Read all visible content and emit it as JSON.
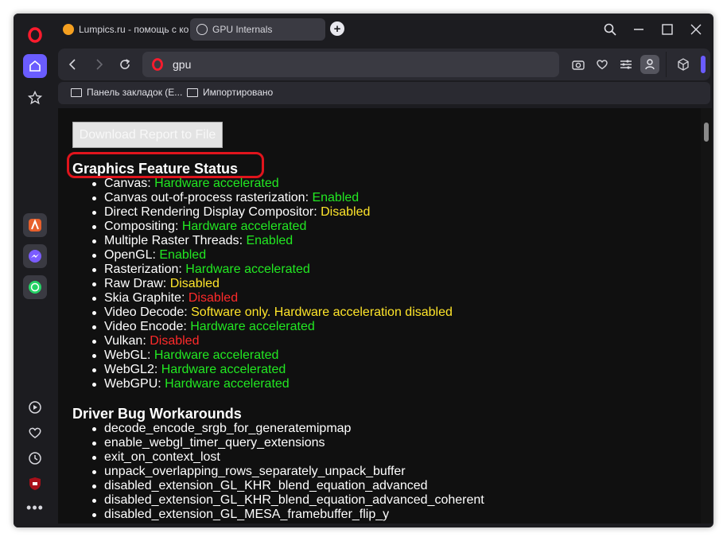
{
  "tabs": [
    {
      "title": "Lumpics.ru - помощь с ко",
      "active": false
    },
    {
      "title": "GPU Internals",
      "active": true
    }
  ],
  "address": {
    "url": "gpu"
  },
  "bookmarks": [
    {
      "label": "Панель закладок (E..."
    },
    {
      "label": "Импортировано"
    }
  ],
  "page": {
    "download_button": "Download Report to File",
    "feature_heading": "Graphics Feature Status",
    "features": [
      {
        "name": "Canvas",
        "status": "Hardware accelerated",
        "color": "#22e822"
      },
      {
        "name": "Canvas out-of-process rasterization",
        "status": "Enabled",
        "color": "#22e822"
      },
      {
        "name": "Direct Rendering Display Compositor",
        "status": "Disabled",
        "color": "#ffe52a"
      },
      {
        "name": "Compositing",
        "status": "Hardware accelerated",
        "color": "#22e822"
      },
      {
        "name": "Multiple Raster Threads",
        "status": "Enabled",
        "color": "#22e822"
      },
      {
        "name": "OpenGL",
        "status": "Enabled",
        "color": "#22e822"
      },
      {
        "name": "Rasterization",
        "status": "Hardware accelerated",
        "color": "#22e822"
      },
      {
        "name": "Raw Draw",
        "status": "Disabled",
        "color": "#ffe52a"
      },
      {
        "name": "Skia Graphite",
        "status": "Disabled",
        "color": "#ff2a2a"
      },
      {
        "name": "Video Decode",
        "status": "Software only. Hardware acceleration disabled",
        "color": "#ffe52a"
      },
      {
        "name": "Video Encode",
        "status": "Hardware accelerated",
        "color": "#22e822"
      },
      {
        "name": "Vulkan",
        "status": "Disabled",
        "color": "#ff2a2a"
      },
      {
        "name": "WebGL",
        "status": "Hardware accelerated",
        "color": "#22e822"
      },
      {
        "name": "WebGL2",
        "status": "Hardware accelerated",
        "color": "#22e822"
      },
      {
        "name": "WebGPU",
        "status": "Hardware accelerated",
        "color": "#22e822"
      }
    ],
    "workarounds_heading": "Driver Bug Workarounds",
    "workarounds": [
      "decode_encode_srgb_for_generatemipmap",
      "enable_webgl_timer_query_extensions",
      "exit_on_context_lost",
      "unpack_overlapping_rows_separately_unpack_buffer",
      "disabled_extension_GL_KHR_blend_equation_advanced",
      "disabled_extension_GL_KHR_blend_equation_advanced_coherent",
      "disabled_extension_GL_MESA_framebuffer_flip_y"
    ]
  },
  "colors": {
    "accent": "#6a5cff",
    "opera_red": "#ff1b2d",
    "highlight": "#e0141c"
  }
}
